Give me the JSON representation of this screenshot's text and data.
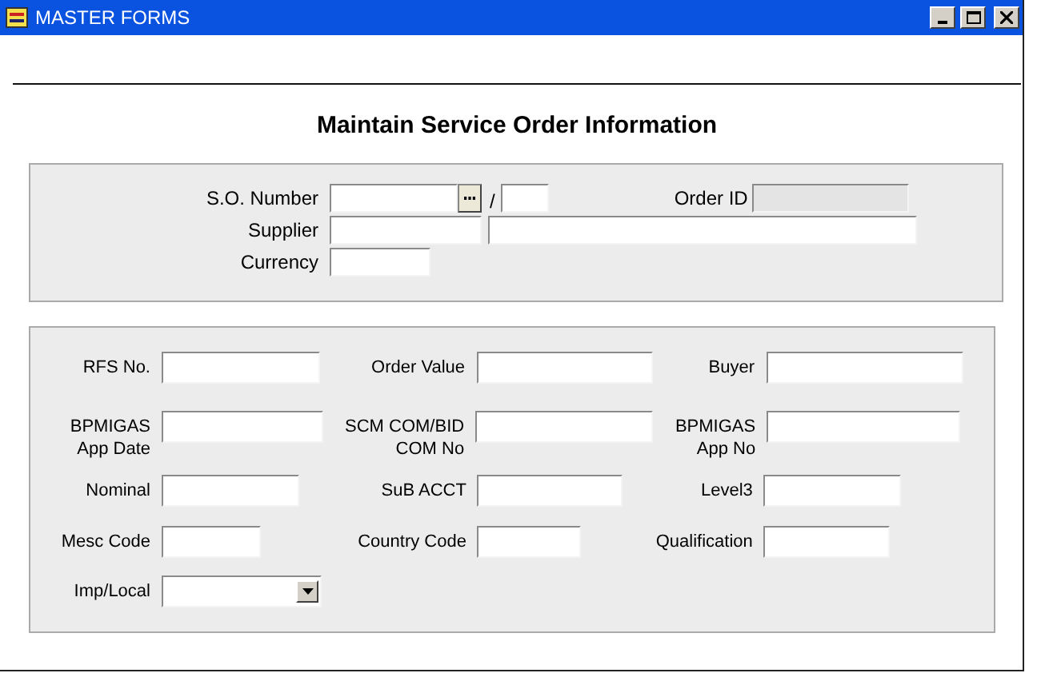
{
  "window": {
    "title": "MASTER FORMS"
  },
  "heading": "Maintain Service Order Information",
  "header_panel": {
    "so_number": {
      "label": "S.O. Number",
      "separator": "/"
    },
    "order_id": {
      "label": "Order ID",
      "disabled": true
    },
    "supplier": {
      "label": "Supplier"
    },
    "currency": {
      "label": "Currency"
    }
  },
  "detail_panel": {
    "rows": [
      [
        {
          "label": "RFS No.",
          "kind": "text"
        },
        {
          "label": "Order Value",
          "kind": "text"
        },
        {
          "label": "Buyer",
          "kind": "text"
        }
      ],
      [
        {
          "label": "BPMIGAS\nApp Date",
          "kind": "text"
        },
        {
          "label": "SCM COM/BID\nCOM No",
          "kind": "text"
        },
        {
          "label": "BPMIGAS\nApp No",
          "kind": "text"
        }
      ],
      [
        {
          "label": "Nominal",
          "kind": "text"
        },
        {
          "label": "SuB ACCT",
          "kind": "text"
        },
        {
          "label": "Level3",
          "kind": "text"
        }
      ],
      [
        {
          "label": "Mesc Code",
          "kind": "text"
        },
        {
          "label": "Country Code",
          "kind": "text"
        },
        {
          "label": "Qualification",
          "kind": "text"
        }
      ],
      [
        {
          "label": "Imp/Local",
          "kind": "dropdown"
        }
      ]
    ]
  }
}
